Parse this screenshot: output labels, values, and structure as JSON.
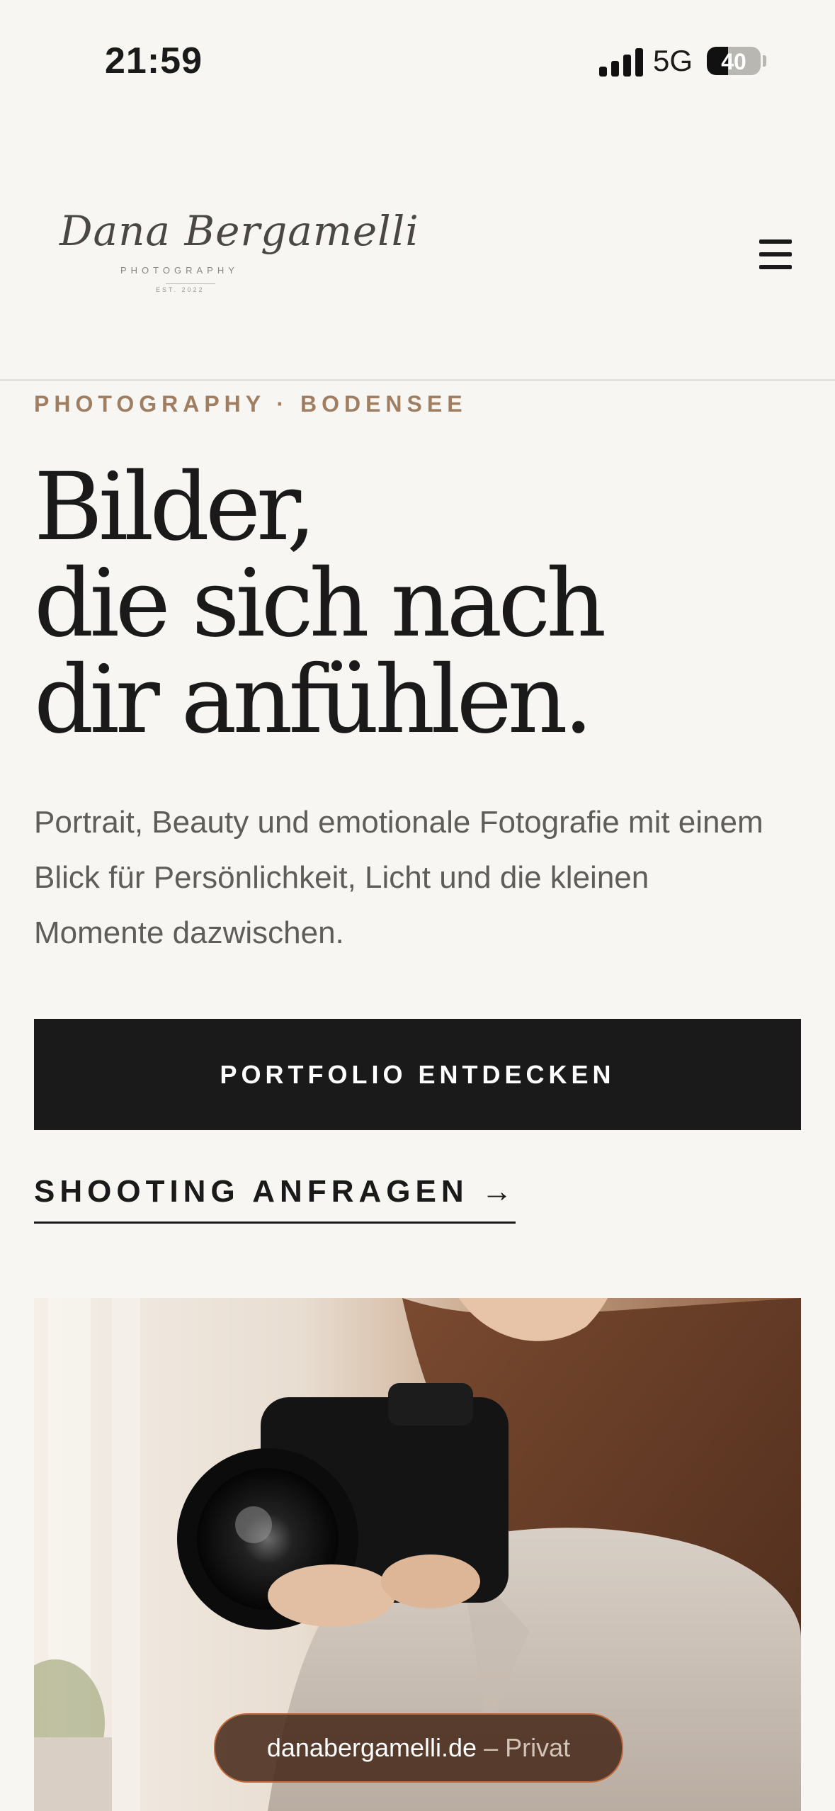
{
  "status_bar": {
    "time": "21:59",
    "network": "5G",
    "battery_level": "40",
    "battery_fraction": 0.4
  },
  "header": {
    "logo_script": "Dana Bergamelli",
    "logo_sub": "PHOTOGRAPHY",
    "logo_est": "EST. 2022",
    "menu_icon": "hamburger-menu-icon"
  },
  "hero": {
    "eyebrow": "PHOTOGRAPHY · BODENSEE",
    "headline_lines": [
      "Bilder,",
      "die sich nach",
      "dir anfühlen."
    ],
    "lead": "Portrait, Beauty und emotionale Fotografie mit einem Blick für Persönlichkeit, Licht und die kleinen Momente dazwischen.",
    "primary_cta": "PORTFOLIO ENTDECKEN",
    "secondary_cta": "SHOOTING ANFRAGEN",
    "secondary_cta_arrow": "→"
  },
  "browser": {
    "domain": "danabergamelli.de",
    "separator": "–",
    "mode_label": "Privat"
  },
  "colors": {
    "background": "#f7f6f3",
    "accent": "#a07e62",
    "text": "#1a1a1a",
    "button": "#1b1a1a",
    "pill_border": "#c06a3c"
  }
}
